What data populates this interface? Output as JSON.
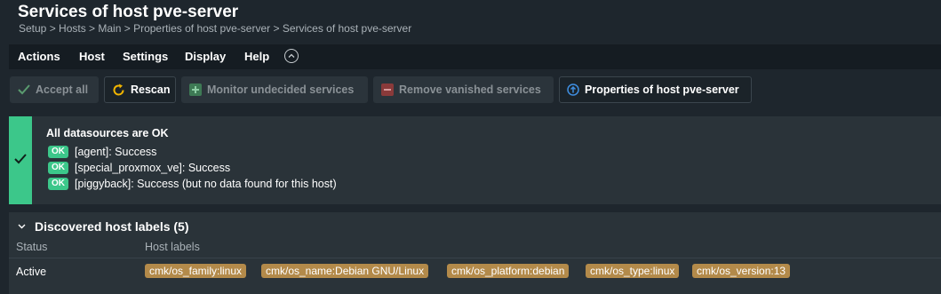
{
  "header": {
    "title": "Services of host pve-server",
    "breadcrumb": "Setup > Hosts > Main > Properties of host pve-server > Services of host pve-server"
  },
  "menu": {
    "items": [
      "Actions",
      "Host",
      "Settings",
      "Display",
      "Help"
    ]
  },
  "toolbar": {
    "accept_all": "Accept all",
    "rescan": "Rescan",
    "monitor_undecided": "Monitor undecided services",
    "remove_vanished": "Remove vanished services",
    "properties": "Properties of host pve-server"
  },
  "status": {
    "heading": "All datasources are OK",
    "badge": "OK",
    "lines": [
      "[agent]: Success",
      "[special_proxmox_ve]: Success",
      "[piggyback]: Success (but no data found for this host)"
    ]
  },
  "host_labels": {
    "title": "Discovered host labels (5)",
    "columns": [
      "Status",
      "Host labels"
    ],
    "row_status": "Active",
    "labels": [
      "cmk/os_family:linux",
      "cmk/os_name:Debian GNU/Linux",
      "cmk/os_platform:debian",
      "cmk/os_type:linux",
      "cmk/os_version:13"
    ]
  },
  "colors": {
    "ok_green": "#3cc78a",
    "label_chip": "#b38a4a",
    "background": "#1e262d",
    "panel": "#2a3339"
  }
}
